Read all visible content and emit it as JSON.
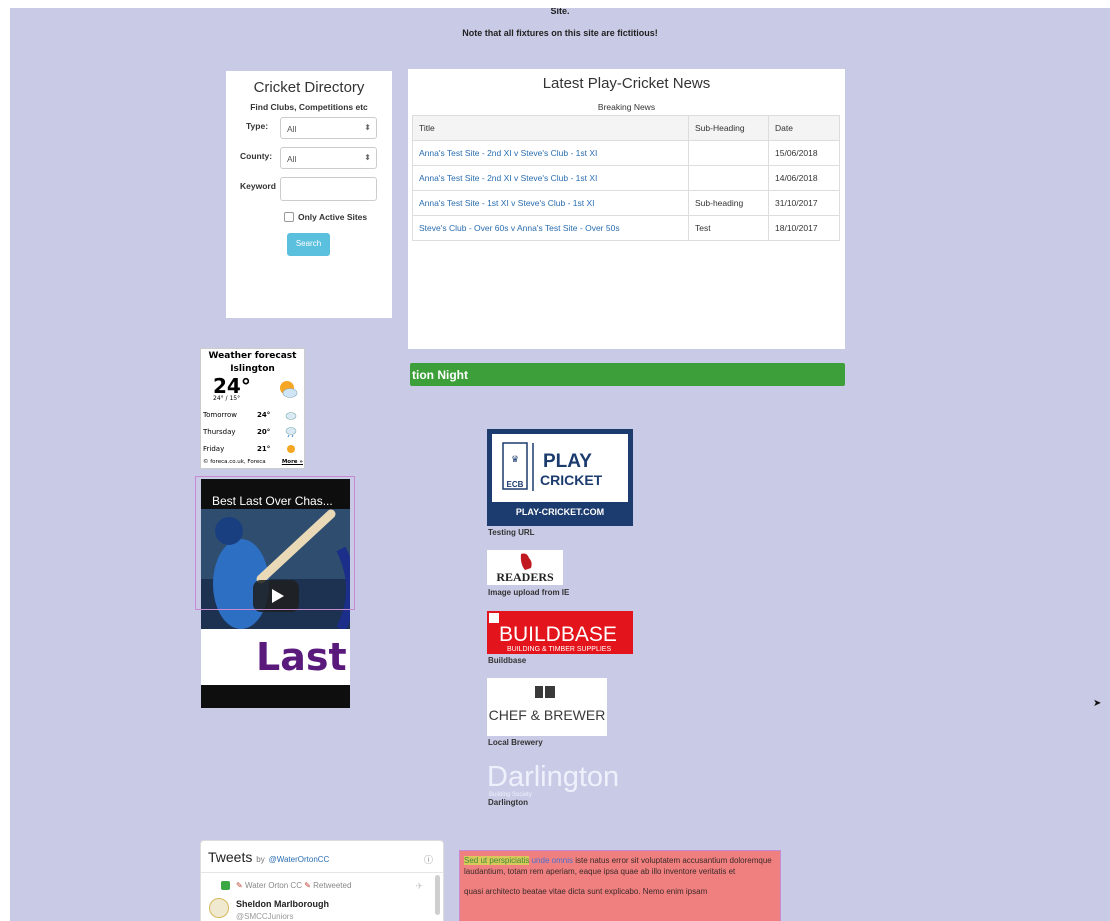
{
  "header": {
    "site_line": "Site.",
    "notice": "Note that all fixtures on this site are fictitious!"
  },
  "directory": {
    "title": "Cricket Directory",
    "subtitle": "Find Clubs, Competitions etc",
    "type_label": "Type:",
    "type_value": "All",
    "county_label": "County:",
    "county_value": "All",
    "keyword_label": "Keyword",
    "keyword_value": "",
    "only_active_label": "Only Active Sites",
    "search_button": "Search"
  },
  "news": {
    "title": "Latest Play-Cricket News",
    "subtitle": "Breaking News",
    "columns": [
      "Title",
      "Sub-Heading",
      "Date"
    ],
    "rows": [
      {
        "title": "Anna's Test Site - 2nd XI v Steve's Club - 1st XI",
        "sub": "",
        "date": "15/06/2018"
      },
      {
        "title": "Anna's Test Site - 2nd XI v Steve's Club - 1st XI",
        "sub": "",
        "date": "14/06/2018"
      },
      {
        "title": "Anna's Test Site - 1st XI v Steve's Club - 1st XI",
        "sub": "Sub-heading",
        "date": "31/10/2017"
      },
      {
        "title": "Steve's Club - Over 60s v Anna's Test Site - Over 50s",
        "sub": "Test",
        "date": "18/10/2017"
      }
    ]
  },
  "banner": {
    "text": "tion Night"
  },
  "weather": {
    "heading_line1": "Weather forecast",
    "heading_line2": "Islington",
    "current_temp": "24°",
    "range": "24° / 15°",
    "days": [
      {
        "day": "Tomorrow",
        "temp": "24°",
        "icon": "cloud-icon"
      },
      {
        "day": "Thursday",
        "temp": "20°",
        "icon": "rain-cloud-icon"
      },
      {
        "day": "Friday",
        "temp": "21°",
        "icon": "sun-icon"
      }
    ],
    "footer_source": "© foreca.co.uk, Foreca",
    "footer_more": "More »"
  },
  "video": {
    "title": "Best Last Over Chas...",
    "overlay_text": "Last"
  },
  "sponsors": [
    {
      "name": "play-cricket",
      "logo_lines": [
        "PLAY",
        "CRICKET",
        "PLAY-CRICKET.COM",
        "ECB"
      ],
      "caption": "Testing URL"
    },
    {
      "name": "readers",
      "logo_text": "READERS",
      "caption": "Image upload from IE"
    },
    {
      "name": "buildbase",
      "logo_text": "BUILDBASE",
      "logo_sub": "BUILDING & TIMBER SUPPLIES",
      "caption": "Buildbase"
    },
    {
      "name": "chef-brewer",
      "logo_text": "CHEF & BREWER",
      "caption": "Local Brewery"
    },
    {
      "name": "darlington",
      "logo_text": "Darlington",
      "logo_sub": "Building Society",
      "caption": "Darlington"
    }
  ],
  "tweets": {
    "title": "Tweets",
    "by": "by",
    "handle": "@WaterOrtonCC",
    "retweet_user": "Water Orton CC",
    "retweeted": "Retweeted",
    "author_name": "Sheldon Marlborough",
    "author_handle": "@SMCCJuniors"
  },
  "lorem": {
    "hl1": "Sed ut perspiciatis",
    "hl2": "unde omnis",
    "line1_rest": "iste natus error sit voluptatem accusantium doloremque laudantium, totam rem aperiam, eaque ipsa quae ab illo inventore veritatis et",
    "line2": "quasi architecto beatae vitae dicta sunt explicabo. Nemo enim ipsam"
  },
  "colors": {
    "page_bg": "#c9cbe6",
    "green_bar": "#3c9f3a",
    "search_button": "#5bc0de",
    "link": "#2a6db0",
    "lorem_bg": "#f0807f"
  }
}
